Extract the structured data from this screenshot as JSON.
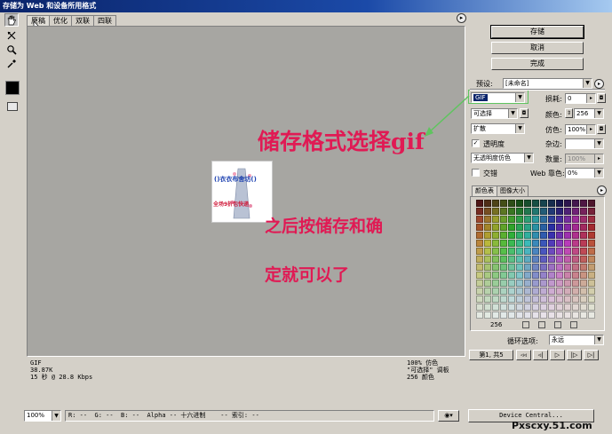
{
  "window": {
    "title": "存储为 Web 和设备所用格式"
  },
  "tabs": [
    {
      "label": "原稿",
      "active": true
    },
    {
      "label": "优化",
      "active": false
    },
    {
      "label": "双联",
      "active": false
    },
    {
      "label": "四联",
      "active": false
    }
  ],
  "tools": [
    "hand-icon",
    "slice-select-icon",
    "zoom-icon",
    "eyedropper-icon"
  ],
  "canvas": {
    "image_text_top": "()衣衣布舍坊()",
    "image_text_bottom": "全场9折包快递",
    "info_left": [
      "GIF",
      "38.87K",
      "15 秒 @ 28.8 Kbps"
    ],
    "info_right": [
      "100% 仿色",
      "\"可选择\" 调板",
      "256 颜色"
    ]
  },
  "annotations": {
    "line1": "储存格式选择gif",
    "line2": "之后按储存和确",
    "line3": "定就可以了"
  },
  "buttons": {
    "save": "存储",
    "cancel": "取消",
    "done": "完成"
  },
  "settings": {
    "preset_label": "预设:",
    "preset_value": "[未命名]",
    "format_value": "GIF",
    "lossy_label": "损耗:",
    "lossy_value": "0",
    "reduction_value": "可选择",
    "colors_label": "颜色:",
    "colors_value": "256",
    "dither_algo_value": "扩散",
    "dither_label": "仿色:",
    "dither_value": "100%",
    "transparency_label": "透明度",
    "transparency_checked": true,
    "matte_label": "杂边:",
    "matte_value": "",
    "transp_dither_value": "无透明度仿色",
    "amount_label": "数量:",
    "amount_value": "100%",
    "interlaced_label": "交错",
    "interlaced_checked": false,
    "websnap_label": "Web 靠色:",
    "websnap_value": "0%"
  },
  "palette": {
    "tabs": [
      "颜色表",
      "图像大小"
    ],
    "count": "256"
  },
  "animation": {
    "loop_label": "循环选项:",
    "loop_value": "永远",
    "frame_label": "第1, 共5"
  },
  "statusbar": {
    "zoom": "100%",
    "readout": "R: --  G: --  B: --  Alpha -- 十六进制    -- 索引: --",
    "device_central": "Device Central..."
  },
  "watermark": "Pxscxy.51.com",
  "colors": {
    "accent_red": "#e01a54",
    "callout_green": "#5fc45f",
    "canvas_gray": "#a7a6a2"
  }
}
